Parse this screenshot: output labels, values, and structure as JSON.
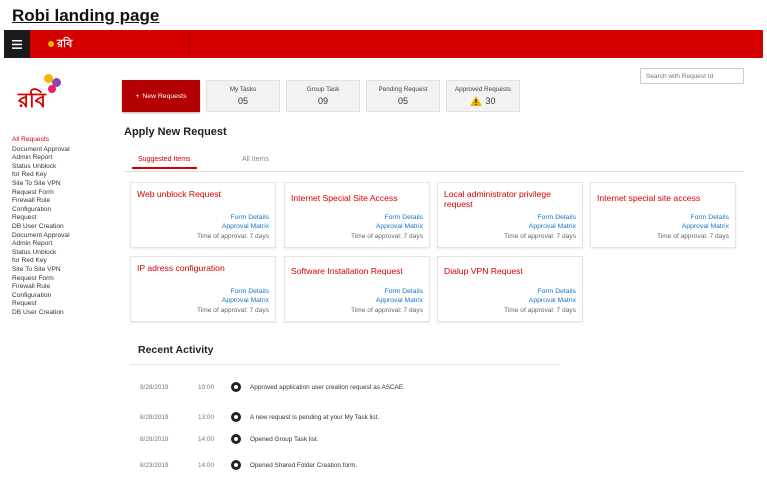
{
  "page_heading": "Robi landing page",
  "topbar": {
    "menu_icon": "hamburger-icon",
    "logo_text": "রবি",
    "brand_color": "#d40000"
  },
  "sidebar_logo": {
    "text": "রবি"
  },
  "sidebar": {
    "title": "All Requests",
    "items": [
      "Document Approval",
      "Admin Report",
      "Status Unblock",
      "for Red Key",
      "Site To Site VPN",
      "Request Form",
      "Firewall Rule",
      "Configuration",
      "Request",
      "DB User Creation",
      "Document Approval",
      "Admin Report",
      "Status Unblock",
      "for Red Key",
      "Site To Site VPN",
      "Request Form",
      "Firewall Rule",
      "Configuration",
      "Request",
      "DB User Creation"
    ]
  },
  "search": {
    "placeholder": "Search with Request Id"
  },
  "stats": {
    "new_request_label": "New Requests",
    "cards": [
      {
        "label": "My Tasks",
        "value": "05"
      },
      {
        "label": "Group Task",
        "value": "09"
      },
      {
        "label": "Pending Request",
        "value": "05"
      },
      {
        "label": "Approved Requests",
        "value": "30"
      }
    ]
  },
  "section_title": "Apply New Request",
  "tabs": {
    "suggested": "Suggested Items",
    "all": "All Items"
  },
  "cards": [
    {
      "title": "Web unblock Request",
      "link1": "Form Details",
      "link2": "Approval Matrix",
      "time": "Time of approval: 7 days"
    },
    {
      "title": "Internet Special Site Access",
      "link1": "Form Details",
      "link2": "Approval Matrix",
      "time": "Time of approval: 7 days"
    },
    {
      "title": "Local administrator privilege request",
      "link1": "Form Details",
      "link2": "Approval Matrix",
      "time": "Time of approval: 7 days"
    },
    {
      "title": "Internet special site access",
      "link1": "Form Details",
      "link2": "Approval Matrix",
      "time": "Time of approval: 7 days"
    },
    {
      "title": "IP adress configuration",
      "link1": "Form Details",
      "link2": "Approval Matrix",
      "time": "Time of approval: 7 days"
    },
    {
      "title": "Software Installation Request",
      "link1": "Form Details",
      "link2": "Approval Matrix",
      "time": "Time of approval: 7 days"
    },
    {
      "title": "Dialup VPN Request",
      "link1": "Form Details",
      "link2": "Approval Matrix",
      "time": "Time of approval: 7 days"
    }
  ],
  "activity": {
    "title": "Recent Activity",
    "items": [
      {
        "date": "8/28/2019",
        "time": "10:00",
        "text": "Approved application user creation request as ASCAE."
      },
      {
        "date": "8/28/2019",
        "time": "13:00",
        "text": "A new request is pending at your My Task list."
      },
      {
        "date": "8/28/2019",
        "time": "14:00",
        "text": "Opened Group Task list."
      },
      {
        "date": "8/23/2019",
        "time": "14:00",
        "text": "Opened Shared Folder Creation form."
      }
    ]
  }
}
